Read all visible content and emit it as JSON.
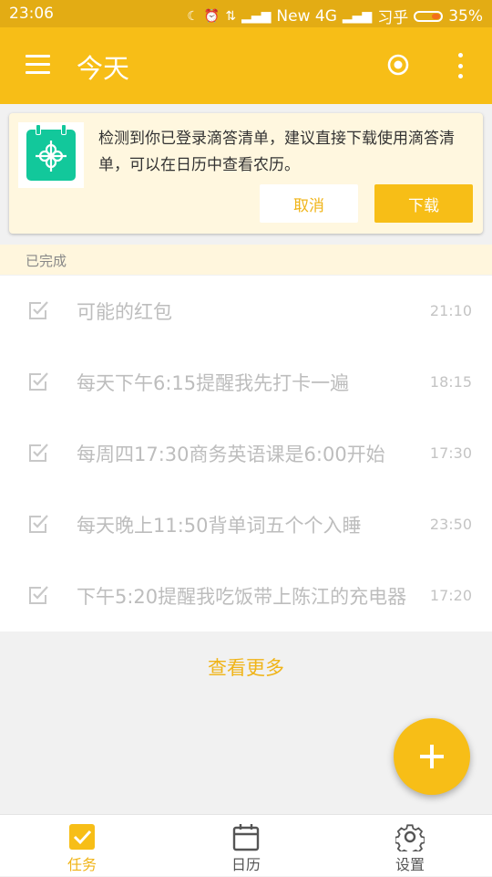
{
  "status_bar": {
    "time": "23:06",
    "network": "New 4G",
    "app": "习乎",
    "battery": "35%"
  },
  "app_bar": {
    "title": "今天",
    "color": "#f7be17"
  },
  "banner": {
    "message": "检测到你已登录滴答清单，建议直接下载使用滴答清单，可以在日历中查看农历。",
    "cancel_label": "取消",
    "download_label": "下载"
  },
  "section": {
    "label": "已完成"
  },
  "tasks": [
    {
      "title": "可能的红包",
      "time": "21:10"
    },
    {
      "title": "每天下午6:15提醒我先打卡一遍",
      "time": "18:15"
    },
    {
      "title": "每周四17:30商务英语课是6:00开始",
      "time": "17:30"
    },
    {
      "title": "每天晚上11:50背单词五个个入睡",
      "time": "23:50"
    },
    {
      "title": "下午5:20提醒我吃饭带上陈江的充电器",
      "time": "17:20"
    }
  ],
  "view_more": "查看更多",
  "bottom_nav": [
    {
      "label": "任务",
      "icon": "task-check-icon",
      "active": true
    },
    {
      "label": "日历",
      "icon": "calendar-icon",
      "active": false
    },
    {
      "label": "设置",
      "icon": "gear-icon",
      "active": false
    }
  ]
}
